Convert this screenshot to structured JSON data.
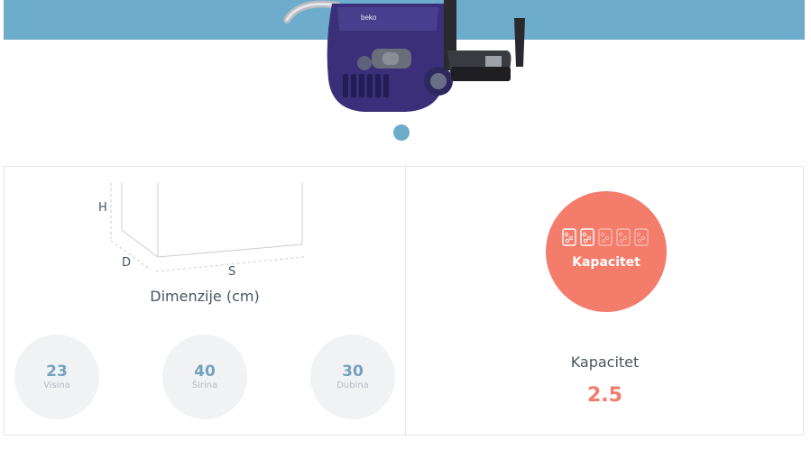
{
  "gallery": {
    "image_alt": "Beko usisivač",
    "brand_mark": "beko",
    "slide_count": 1,
    "active_slide": 1
  },
  "dimensions": {
    "title": "Dimenzije (cm)",
    "diagram_labels": {
      "height": "H",
      "depth": "D",
      "width": "S"
    },
    "items": [
      {
        "value": "23",
        "label": "Visina"
      },
      {
        "value": "40",
        "label": "Širina"
      },
      {
        "value": "30",
        "label": "Dubina"
      }
    ]
  },
  "capacity": {
    "circle_label": "Kapacitet",
    "icons_total": 5,
    "icons_filled": 2,
    "title": "Kapacitet",
    "value": "2.5"
  },
  "colors": {
    "band": "#6eaccc",
    "accent": "#f47c6b",
    "dim_value": "#72a2c0"
  }
}
